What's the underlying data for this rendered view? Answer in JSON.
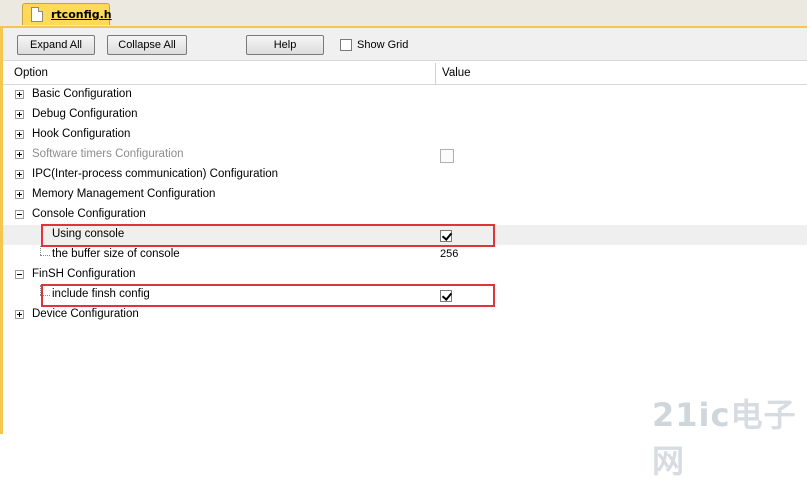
{
  "tab": {
    "title": "rtconfig.h"
  },
  "toolbar": {
    "expand_all": "Expand All",
    "collapse_all": "Collapse All",
    "help": "Help",
    "show_grid": "Show Grid",
    "show_grid_checked": false
  },
  "columns": {
    "option": "Option",
    "value": "Value"
  },
  "tree": [
    {
      "label": "Basic Configuration",
      "expander": "plus"
    },
    {
      "label": "Debug Configuration",
      "expander": "plus"
    },
    {
      "label": "Hook Configuration",
      "expander": "plus"
    },
    {
      "label": "Software timers Configuration",
      "expander": "plus",
      "disabled": true,
      "value_checkbox": false
    },
    {
      "label": "IPC(Inter-process communication) Configuration",
      "expander": "plus"
    },
    {
      "label": "Memory Management Configuration",
      "expander": "plus"
    },
    {
      "label": "Console Configuration",
      "expander": "minus"
    },
    {
      "label": "Using console",
      "child": true,
      "value_checkbox": true
    },
    {
      "label": "the buffer size of console",
      "child": true,
      "value": "256"
    },
    {
      "label": "FinSH Configuration",
      "expander": "minus"
    },
    {
      "label": "include finsh config",
      "child": true,
      "value_checkbox": true
    },
    {
      "label": "Device Configuration",
      "expander": "plus"
    }
  ],
  "colors": {
    "tab_background": "#ffd95a",
    "frame_accent": "#f4c850",
    "highlight_box": "#e0333a"
  },
  "watermark": {
    "text": "21ic",
    "suffix": "电子网"
  }
}
